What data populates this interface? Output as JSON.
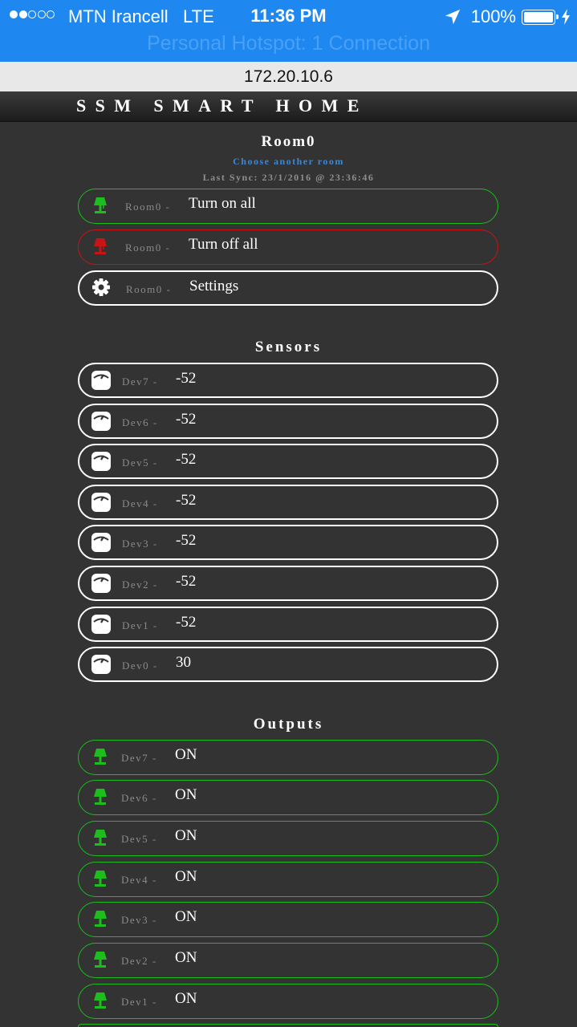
{
  "status_bar": {
    "carrier": "MTN Irancell",
    "network": "LTE",
    "time": "11:36 PM",
    "battery": "100%",
    "hotspot": "Personal Hotspot: 1 Connection"
  },
  "browser": {
    "url": "172.20.10.6"
  },
  "app": {
    "title": "SSM SMART HOME"
  },
  "room": {
    "name": "Room0",
    "choose_link": "Choose another room",
    "last_sync": "Last Sync: 23/1/2016 @ 23:36:46",
    "actions": [
      {
        "device": "Room0 -",
        "label": "Turn on all",
        "icon": "lamp-icon",
        "color": "#1dbd1d"
      },
      {
        "device": "Room0 -",
        "label": "Turn off all",
        "icon": "lamp-icon",
        "color": "#c81414"
      },
      {
        "device": "Room0 -",
        "label": "Settings",
        "icon": "gear-icon",
        "color": "#ffffff"
      }
    ]
  },
  "sensors": {
    "title": "Sensors",
    "items": [
      {
        "device": "Dev7 -",
        "value": "-52",
        "icon": "sensor-icon"
      },
      {
        "device": "Dev6 -",
        "value": "-52",
        "icon": "sensor-icon"
      },
      {
        "device": "Dev5 -",
        "value": "-52",
        "icon": "sensor-icon"
      },
      {
        "device": "Dev4 -",
        "value": "-52",
        "icon": "sensor-icon"
      },
      {
        "device": "Dev3 -",
        "value": "-52",
        "icon": "sensor-icon"
      },
      {
        "device": "Dev2 -",
        "value": "-52",
        "icon": "sensor-icon"
      },
      {
        "device": "Dev1 -",
        "value": "-52",
        "icon": "sensor-icon"
      },
      {
        "device": "Dev0 -",
        "value": "30",
        "icon": "sensor-icon"
      }
    ]
  },
  "outputs": {
    "title": "Outputs",
    "items": [
      {
        "device": "Dev7 -",
        "value": "ON",
        "icon": "lamp-icon",
        "color": "#1dbd1d"
      },
      {
        "device": "Dev6 -",
        "value": "ON",
        "icon": "lamp-icon",
        "color": "#1dbd1d"
      },
      {
        "device": "Dev5 -",
        "value": "ON",
        "icon": "lamp-icon",
        "color": "#1dbd1d"
      },
      {
        "device": "Dev4 -",
        "value": "ON",
        "icon": "lamp-icon",
        "color": "#1dbd1d"
      },
      {
        "device": "Dev3 -",
        "value": "ON",
        "icon": "lamp-icon",
        "color": "#1dbd1d"
      },
      {
        "device": "Dev2 -",
        "value": "ON",
        "icon": "lamp-icon",
        "color": "#1dbd1d"
      },
      {
        "device": "Dev1 -",
        "value": "ON",
        "icon": "lamp-icon",
        "color": "#1dbd1d"
      }
    ]
  },
  "colors": {
    "status_bar": "#1e88f0",
    "background": "#333333",
    "link": "#3b88d6",
    "on": "#1dbd1d",
    "off": "#c81414"
  }
}
